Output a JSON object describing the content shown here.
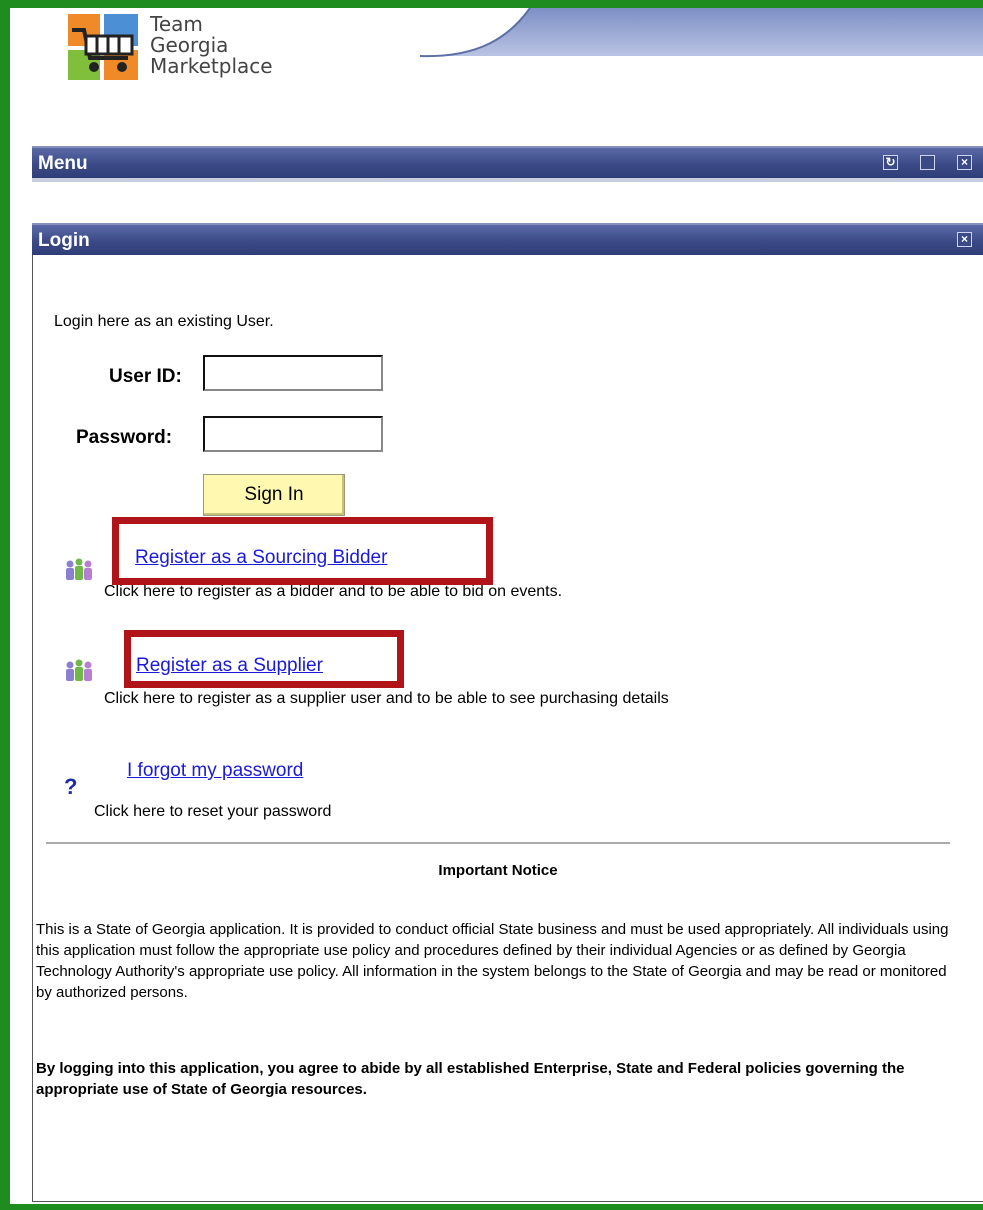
{
  "brand": {
    "line1": "Team",
    "line2": "Georgia",
    "line3": "Marketplace"
  },
  "menu": {
    "title": "Menu"
  },
  "login": {
    "title": "Login",
    "intro": "Login here as an existing User.",
    "user_id_label": "User ID:",
    "password_label": "Password:",
    "user_id_value": "",
    "password_value": "",
    "sign_in": "Sign In"
  },
  "links": [
    {
      "label": "Register as a Sourcing Bidder",
      "description": "Click here to register as a bidder and to be able to bid on events."
    },
    {
      "label": "Register as a Supplier",
      "description": "Click here to register as a supplier user and to be able to see purchasing details"
    },
    {
      "label": "I forgot my password",
      "description": "Click here to reset your password"
    }
  ],
  "notice": {
    "title": "Important Notice",
    "body": "This is a State of Georgia application. It is provided to conduct official State business and must be used appropriately. All individuals using this application must follow the appropriate use policy and procedures defined by their individual Agencies or as defined by Georgia Technology Authority's appropriate use policy. All information in the system belongs to the State of Georgia and may be read or monitored by authorized persons.",
    "agreement": "By logging into this application, you agree to abide by all established Enterprise, State and Federal policies governing the appropriate use of State of Georgia resources."
  },
  "icons": {
    "refresh": "refresh-icon",
    "maximize": "maximize-icon",
    "close": "close-icon",
    "users": "users-icon",
    "help": "question-mark-icon"
  },
  "colors": {
    "frame": "#1e8c1e",
    "bar": "#3b4a86",
    "link": "#1a1ad8",
    "highlight": "#b01318",
    "button": "#fff8b0"
  }
}
